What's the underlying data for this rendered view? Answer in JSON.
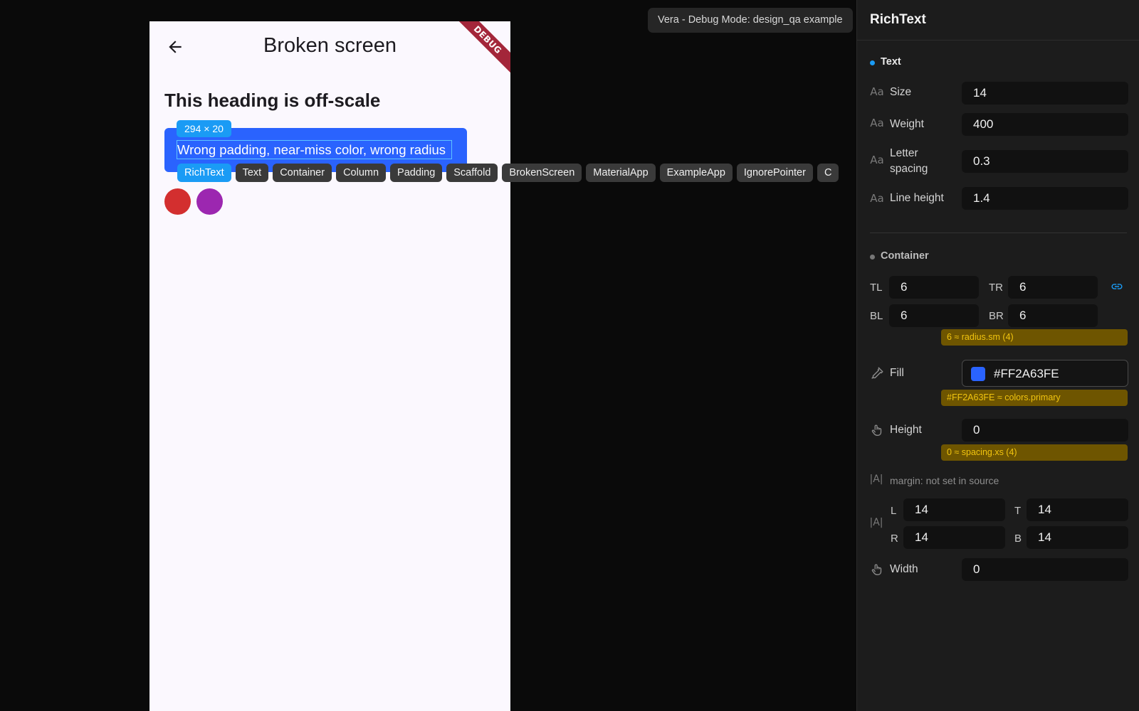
{
  "phone": {
    "appbar_title": "Broken screen",
    "debug_ribbon": "DEBUG",
    "heading": "This heading is off-scale",
    "size_tag": "294 × 20",
    "box_text": "Wrong padding, near-miss color, wrong radius",
    "colors": {
      "box_fill": "#2A63FE",
      "circle_red": "#D32F2F",
      "circle_purple": "#9C27B0"
    }
  },
  "breadcrumb": [
    "RichText",
    "Text",
    "Container",
    "Column",
    "Padding",
    "Scaffold",
    "BrokenScreen",
    "MaterialApp",
    "ExampleApp",
    "IgnorePointer",
    "C"
  ],
  "toast": "Vera - Debug Mode: design_qa example",
  "inspector": {
    "title": "RichText",
    "text_section": {
      "label": "Text",
      "size_label": "Size",
      "size_value": "14",
      "weight_label": "Weight",
      "weight_value": "400",
      "letter_label": "Letter spacing",
      "letter_value": "0.3",
      "line_label": "Line height",
      "line_value": "1.4"
    },
    "container_section": {
      "label": "Container",
      "tl_label": "TL",
      "tl_value": "6",
      "tr_label": "TR",
      "tr_value": "6",
      "bl_label": "BL",
      "bl_value": "6",
      "br_label": "BR",
      "br_value": "6",
      "radius_hint": "6 ≈ radius.sm (4)",
      "fill_label": "Fill",
      "fill_value": "#FF2A63FE",
      "fill_swatch": "#2A63FE",
      "fill_hint": "#FF2A63FE ≈ colors.primary",
      "height_label": "Height",
      "height_value": "0",
      "height_hint": "0 ≈ spacing.xs (4)",
      "margin_note": "margin: not set in source",
      "l_label": "L",
      "l_value": "14",
      "t_label": "T",
      "t_value": "14",
      "r_label": "R",
      "r_value": "14",
      "b_label": "B",
      "b_value": "14",
      "width_label": "Width",
      "width_value": "0"
    }
  }
}
